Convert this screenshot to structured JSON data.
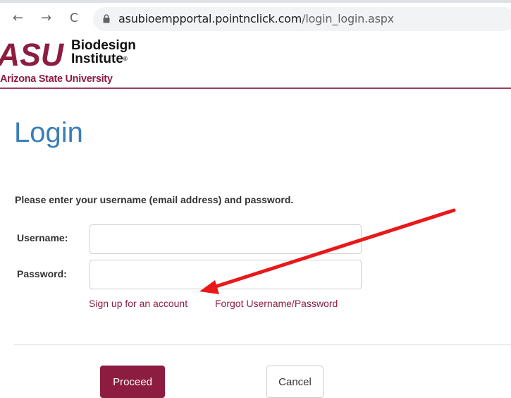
{
  "browser": {
    "back_icon": "←",
    "forward_icon": "→",
    "reload_icon": "C",
    "url_domain": "asubioempportal.pointnclick.com",
    "url_path": "/login_login.aspx"
  },
  "header": {
    "logo_mark": "ASU",
    "logo_line1": "Biodesign",
    "logo_line2": "Institute",
    "university": "Arizona State University",
    "accent_color": "#8c1d40"
  },
  "login": {
    "title": "Login",
    "instructions": "Please enter your username (email address) and password.",
    "username_label": "Username:",
    "username_value": "",
    "password_label": "Password:",
    "password_value": "",
    "signup_link": "Sign up for an account",
    "forgot_link": "Forgot Username/Password",
    "proceed_label": "Proceed",
    "cancel_label": "Cancel",
    "title_color": "#3a7eb8"
  },
  "annotation": {
    "arrow_color": "#e8191a"
  }
}
